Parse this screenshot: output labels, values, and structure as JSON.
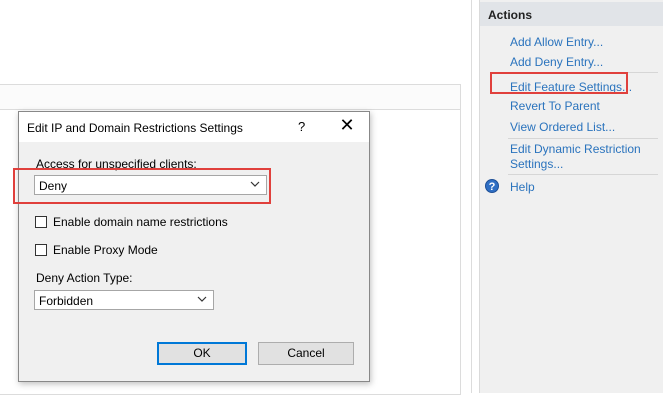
{
  "actions": {
    "title": "Actions",
    "items": [
      "Add Allow Entry...",
      "Add Deny Entry...",
      "Edit Feature Settings...",
      "Revert To Parent",
      "View Ordered List...",
      "Edit Dynamic Restriction",
      "Settings...",
      "Help"
    ],
    "help_icon": "?",
    "link_color": "#2a73bd",
    "highlight_color": "#e0403c"
  },
  "dialog": {
    "title": "Edit IP and Domain Restrictions Settings",
    "help_button": "?",
    "close_button": "✕",
    "access_label": "Access for unspecified clients:",
    "access_value": "Deny",
    "domain_restrictions_label": "Enable domain name restrictions",
    "domain_restrictions_checked": false,
    "proxy_mode_label": "Enable Proxy Mode",
    "proxy_mode_checked": false,
    "deny_action_label": "Deny Action Type:",
    "deny_action_value": "Forbidden",
    "ok_label": "OK",
    "cancel_label": "Cancel"
  }
}
